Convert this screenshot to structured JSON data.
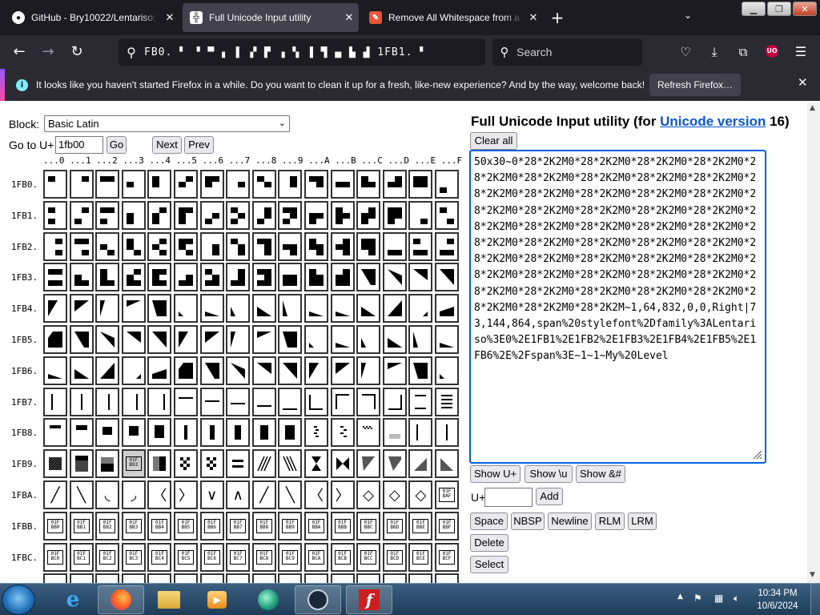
{
  "browser": {
    "tabs": [
      {
        "title": "GitHub - Bry10022/Lentariso: Th",
        "favicon": "github-icon",
        "active": false
      },
      {
        "title": "Full Unicode Input utility",
        "favicon": "unicode-icon",
        "active": true
      },
      {
        "title": "Remove All Whitespace from a",
        "favicon": "tool-icon",
        "active": false
      }
    ],
    "url_text": "FB0. ▘ ▝ ▀ ▖ ▌ ▞ ▛ ▗ ▚ ▐ ▜ ▄ ▙ ▟ 1FB1. ▘",
    "search_placeholder": "Search",
    "notification": {
      "message": "It looks like you haven't started Firefox in a while. Do you want to clean it up for a fresh, like-new experience? And by the way, welcome back!",
      "button": "Refresh Firefox…"
    }
  },
  "left_panel": {
    "block_label": "Block:",
    "block_value": "Basic Latin",
    "goto_label": "Go to U+",
    "goto_value": "1fb00",
    "go_button": "Go",
    "next_button": "Next",
    "prev_button": "Prev",
    "column_header": "...0 ...1 ...2 ...3 ...4 ...5 ...6 ...7 ...8 ...9 ...A ...B ...C ...D ...E ...F",
    "rows": [
      "1FB0.",
      "1FB1.",
      "1FB2.",
      "1FB3.",
      "1FB4.",
      "1FB5.",
      "1FB6.",
      "1FB7.",
      "1FB8.",
      "1FB9.",
      "1FBA.",
      "1FBB.",
      "1FBC.",
      ""
    ],
    "selected_cell": "1FB93",
    "boxed_glyphs": {
      "1FB93": "01F B93",
      "1FBAF": "01F BAF",
      "1FBB0": "01F BB0",
      "1FBB1": "01F BB1",
      "1FBB2": "01F BB2",
      "1FBB3": "01F BB3",
      "1FBB4": "01F BB4",
      "1FBB5": "01F BB5",
      "1FBB6": "01F BB6",
      "1FBB7": "01F BB7",
      "1FBB8": "01F BB8",
      "1FBB9": "01F BB9",
      "1FBBA": "01F BBA",
      "1FBBB": "01F BBB",
      "1FBBC": "01F BBC",
      "1FBBD": "01F BBD",
      "1FBBE": "01F BBE",
      "1FBBF": "01F BBF",
      "1FBC0": "01F BC0",
      "1FBC1": "01F BC1",
      "1FBC2": "01F BC2",
      "1FBC3": "01F BC3",
      "1FBC4": "01F BC4",
      "1FBC5": "01F BC5",
      "1FBC6": "01F BC6",
      "1FBC7": "01F BC7",
      "1FBC8": "01F BC8",
      "1FBC9": "01F BC9",
      "1FBCA": "01F BCA",
      "1FBCB": "01F BCB",
      "1FBCC": "01F BCC",
      "1FBCD": "01F BCD",
      "1FBCE": "01F BCE",
      "1FBCF": "01F BCF"
    },
    "line_glyphs": {
      "1FBA0": "╱",
      "1FBA1": "╲",
      "1FBA2": "◟",
      "1FBA3": "◞",
      "1FBA4": "〈",
      "1FBA5": "〉",
      "1FBA6": "∨",
      "1FBA7": "∧",
      "1FBA8": "╱",
      "1FBA9": "╲",
      "1FBAA": "〈",
      "1FBAB": "〉",
      "1FBAC": "◇",
      "1FBAD": "◇",
      "1FBAE": "◇"
    }
  },
  "right_panel": {
    "title_prefix": "Full Unicode Input utility (for ",
    "title_link": "Unicode version",
    "title_suffix": " 16)",
    "clear_button": "Clear all",
    "textarea_value": "50x30~0*28*2K2M0*28*2K2M0*28*2K2M0*28*2K2M0*28*2K2M0*28*2K2M0*28*2K2M0*28*2K2M0*28*2K2M0*28*2K2M0*28*2K2M0*28*2K2M0*28*2K2M0*28*2K2M0*28*2K2M0*28*2K2M0*28*2K2M0*28*2K2M0*28*2K2M0*28*2K2M0*28*2K2M0*28*2K2M0*28*2K2M0*28*2K2M0*28*2K2M0*28*2K2M0*28*2K2M0*28*2K2M0*28*2K2M0*28*2K2M0*28*2K2M0*28*2K2M0*28*2K2M0*28*2K2M0*28*2K2M0*28*2K2M0*28*2K2M0*28*2K2M0*28*2K2M0*28*2K2M0*28*2K2M0*28*2K2M0*28*2K2M0*28*2K2M0*28*2K2M0*28*2K2M0*28*2K2M~1,64,832,0,0,Right|73,144,864,span%20stylefont%2Dfamily%3ALentariso%3E0%2E1FB1%2E1FB2%2E1FB3%2E1FB4%2E1FB5%2E1FB6%2E%2Fspan%3E~1~1~My%20Level",
    "show_uplus": "Show U+",
    "show_backslash": "Show \\u",
    "show_amp": "Show &#",
    "uplus_label": "U+",
    "add_button": "Add",
    "space_button": "Space",
    "nbsp_button": "NBSP",
    "newline_button": "Newline",
    "rlm_button": "RLM",
    "lrm_button": "LRM",
    "delete_button": "Delete",
    "select_button": "Select"
  },
  "taskbar": {
    "time": "10:34 PM",
    "date": "10/6/2024",
    "apps": [
      "ie-icon",
      "firefox-icon",
      "explorer-icon",
      "media-player-icon",
      "app-icon",
      "steam-icon",
      "flash-icon"
    ]
  }
}
